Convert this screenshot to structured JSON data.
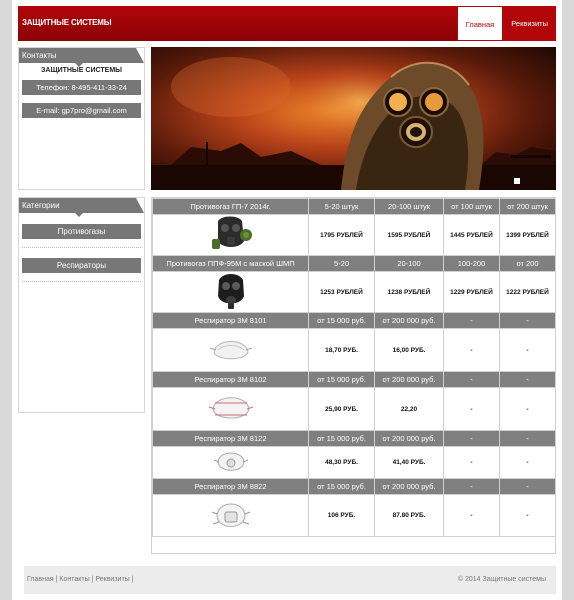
{
  "header": {
    "logo": "Защитные системы",
    "nav": [
      {
        "label": "Главная",
        "active": true
      },
      {
        "label": "Реквизиты",
        "active": false
      }
    ]
  },
  "contacts": {
    "title": "Контакты",
    "company": "ЗАЩИТНЫЕ СИСТЕМЫ",
    "phone": "Телефон: 8-495-411-33-24",
    "email": "E-mail: gp7pro@gmail.com"
  },
  "categories": {
    "title": "Категории",
    "items": [
      "Противогазы",
      "Респираторы"
    ]
  },
  "products": [
    {
      "name": "Противогаз ГП-7 2014г.",
      "tiers": [
        "5-20 штук",
        "20-100 штук",
        "от 100 штук",
        "от 200 штук"
      ],
      "prices": [
        "1795 РУБЛЕЙ",
        "1595 РУБЛЕЙ",
        "1445 РУБЛЕЙ",
        "1399 РУБЛЕЙ"
      ],
      "icon": "gas-mask-gp7-icon"
    },
    {
      "name": "Противогаз ППФ-95М с маской ШМП",
      "tiers": [
        "5-20",
        "20-100",
        "100-200",
        "от 200"
      ],
      "prices": [
        "1253 РУБЛЕЙ",
        "1238 РУБЛЕЙ",
        "1229 РУБЛЕЙ",
        "1222 РУБЛЕЙ"
      ],
      "icon": "gas-mask-ppf-icon"
    },
    {
      "name": "Респиратор 3М 8101",
      "tiers": [
        "от 15 000 руб.",
        "от 200 000 руб.",
        "-",
        "-"
      ],
      "prices": [
        "18,70 РУБ.",
        "16,00 РУБ.",
        "-",
        "-"
      ],
      "icon": "respirator-8101-icon"
    },
    {
      "name": "Респиратор 3М 8102",
      "tiers": [
        "от 15 000 руб.",
        "от 200 000 руб.",
        "-",
        "-"
      ],
      "prices": [
        "25,90 РУБ.",
        "22,20",
        "-",
        "-"
      ],
      "icon": "respirator-8102-icon"
    },
    {
      "name": "Респиратор 3М 8122",
      "tiers": [
        "от 15 000 руб.",
        "от 200 000 руб.",
        "-",
        "-"
      ],
      "prices": [
        "48,30 РУБ.",
        "41,40 РУБ.",
        "-",
        "-"
      ],
      "icon": "respirator-8122-icon"
    },
    {
      "name": "Респиратор 3М 8822",
      "tiers": [
        "от 15 000 руб.",
        "от 200 000 руб.",
        "-",
        "-"
      ],
      "prices": [
        "106 РУБ.",
        "87.80 РУБ.",
        "-",
        "-"
      ],
      "icon": "respirator-8822-icon"
    }
  ],
  "footer": {
    "links": [
      "Главная",
      "Контакты",
      "Реквизиты"
    ],
    "separator": "|",
    "copyright": "© 2014 Защитные системы"
  },
  "colors": {
    "brand": "#b1060a",
    "header_gray": "#808080"
  }
}
